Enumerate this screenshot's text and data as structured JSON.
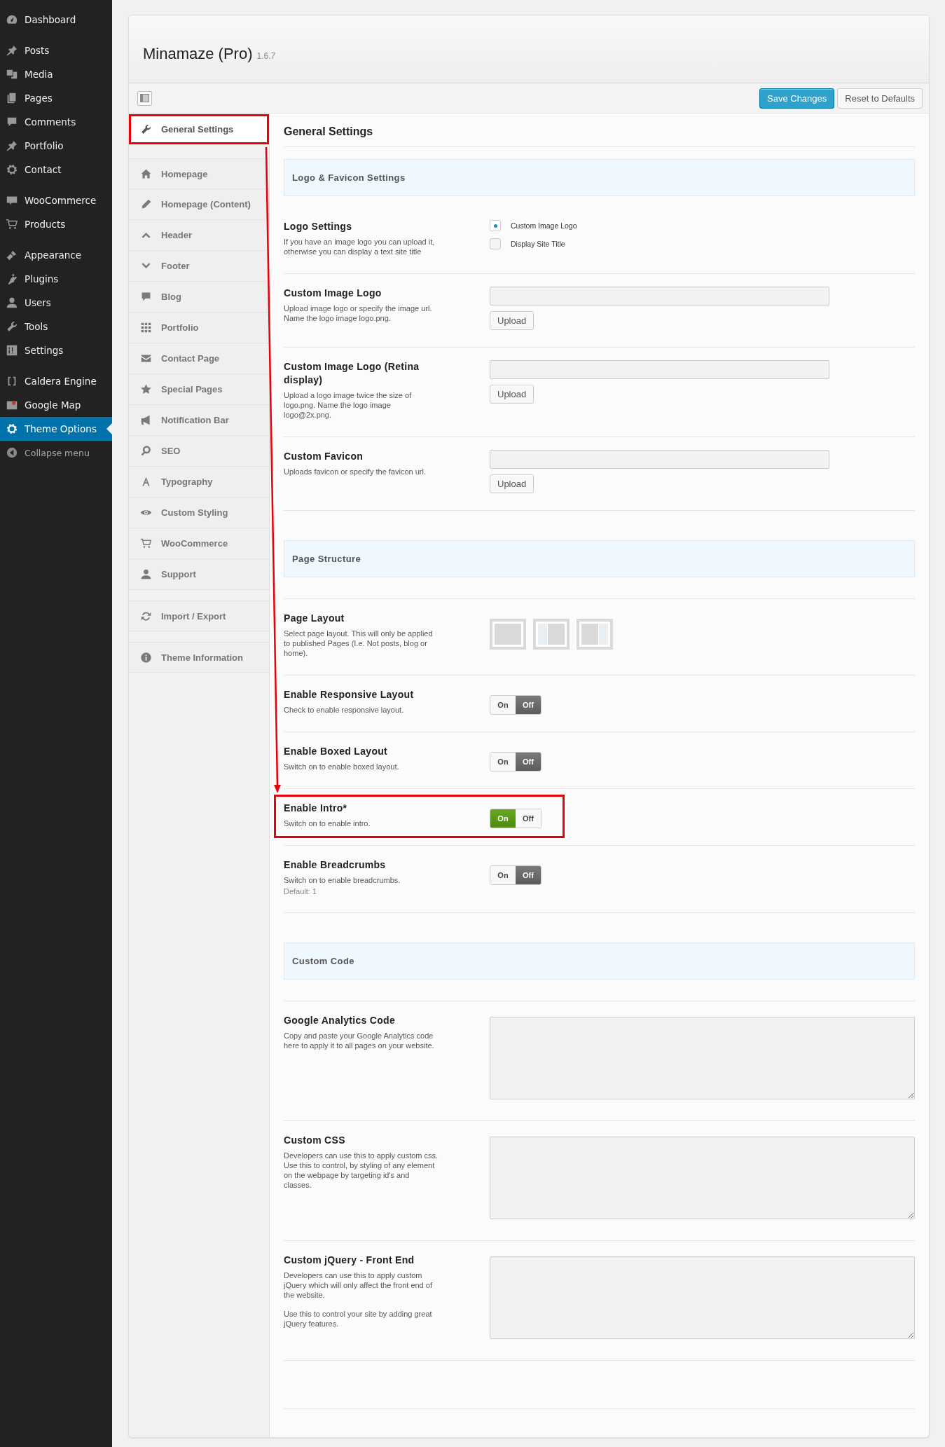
{
  "admin_menu": {
    "groups": [
      [
        {
          "label": "Dashboard",
          "selected": false
        }
      ],
      [
        {
          "label": "Posts",
          "selected": false
        },
        {
          "label": "Media",
          "selected": false
        },
        {
          "label": "Pages",
          "selected": false
        },
        {
          "label": "Comments",
          "selected": false
        },
        {
          "label": "Portfolio",
          "selected": false
        },
        {
          "label": "Contact",
          "selected": false
        }
      ],
      [
        {
          "label": "WooCommerce",
          "selected": false
        },
        {
          "label": "Products",
          "selected": false
        }
      ],
      [
        {
          "label": "Appearance",
          "selected": false
        },
        {
          "label": "Plugins",
          "selected": false
        },
        {
          "label": "Users",
          "selected": false
        },
        {
          "label": "Tools",
          "selected": false
        },
        {
          "label": "Settings",
          "selected": false
        }
      ],
      [
        {
          "label": "Caldera Engine",
          "selected": false
        },
        {
          "label": "Google Map",
          "selected": false
        },
        {
          "label": "Theme Options",
          "selected": true
        }
      ]
    ],
    "collapse": "Collapse menu"
  },
  "panel": {
    "title": "Minamaze (Pro)",
    "version": "1.6.7",
    "buttons": [
      {
        "label": "Save Changes",
        "kind": "primary"
      },
      {
        "label": "Reset to Defaults",
        "kind": "secondary"
      }
    ]
  },
  "nav": {
    "groups": [
      [
        {
          "label": "General Settings",
          "selected": true,
          "highlighted": true
        }
      ],
      [
        {
          "label": "Homepage",
          "selected": false,
          "highlighted": false
        },
        {
          "label": "Homepage (Content)",
          "selected": false,
          "highlighted": false
        },
        {
          "label": "Header",
          "selected": false,
          "highlighted": false
        },
        {
          "label": "Footer",
          "selected": false,
          "highlighted": false
        },
        {
          "label": "Blog",
          "selected": false,
          "highlighted": false
        },
        {
          "label": "Portfolio",
          "selected": false,
          "highlighted": false
        },
        {
          "label": "Contact Page",
          "selected": false,
          "highlighted": false
        },
        {
          "label": "Special Pages",
          "selected": false,
          "highlighted": false
        },
        {
          "label": "Notification Bar",
          "selected": false,
          "highlighted": false
        },
        {
          "label": "SEO",
          "selected": false,
          "highlighted": false
        },
        {
          "label": "Typography",
          "selected": false,
          "highlighted": false
        },
        {
          "label": "Custom Styling",
          "selected": false,
          "highlighted": false
        },
        {
          "label": "WooCommerce",
          "selected": false,
          "highlighted": false
        },
        {
          "label": "Support",
          "selected": false,
          "highlighted": false
        }
      ],
      [
        {
          "label": "Import / Export",
          "selected": false,
          "highlighted": false
        }
      ],
      [
        {
          "label": "Theme Information",
          "selected": false,
          "highlighted": false
        }
      ]
    ]
  },
  "content": {
    "title": "General Settings",
    "sections": [
      {
        "title": "Logo & Favicon Settings",
        "fields": [
          {
            "kind": "radio",
            "title": "Logo Settings",
            "description": [
              "If you have an image logo you can upload it, otherwise you can display a text site title"
            ],
            "highlighted": false,
            "options": [
              {
                "label": "Custom Image Logo",
                "selected": true
              },
              {
                "label": "Display Site Title",
                "selected": false
              }
            ]
          },
          {
            "kind": "upload",
            "title": "Custom Image Logo",
            "description": [
              "Upload image logo or specify the image url. Name the logo image logo.png."
            ],
            "highlighted": false,
            "button": "Upload"
          },
          {
            "kind": "upload",
            "title": "Custom Image Logo (Retina display)",
            "description": [
              "Upload a logo image twice the size of logo.png. Name the logo image logo@2x.png."
            ],
            "highlighted": false,
            "button": "Upload"
          },
          {
            "kind": "upload",
            "title": "Custom Favicon",
            "description": [
              "Uploads favicon or specify the favicon url."
            ],
            "highlighted": false,
            "button": "Upload"
          }
        ]
      },
      {
        "title": "Page Structure",
        "fields": [
          {
            "kind": "layout",
            "title": "Page Layout",
            "description": [
              "Select page layout. This will only be applied to published Pages (I.e. Not posts, blog or home)."
            ],
            "highlighted": false,
            "options": [
              {
                "kind": "full"
              },
              {
                "kind": "left"
              },
              {
                "kind": "right"
              }
            ]
          },
          {
            "kind": "toggle",
            "title": "Enable Responsive Layout",
            "description": [
              "Check to enable responsive layout."
            ],
            "highlighted": false,
            "on": false,
            "on_label": "On",
            "off_label": "Off"
          },
          {
            "kind": "toggle",
            "title": "Enable Boxed Layout",
            "description": [
              "Switch on to enable boxed layout."
            ],
            "highlighted": false,
            "on": false,
            "on_label": "On",
            "off_label": "Off"
          },
          {
            "kind": "toggle",
            "title": "Enable Intro*",
            "description": [
              "Switch on to enable intro."
            ],
            "highlighted": true,
            "on": true,
            "on_label": "On",
            "off_label": "Off"
          },
          {
            "kind": "toggle",
            "title": "Enable Breadcrumbs",
            "description": [
              "Switch on to enable breadcrumbs."
            ],
            "note": "Default: 1",
            "highlighted": false,
            "on": false,
            "on_label": "On",
            "off_label": "Off"
          }
        ]
      },
      {
        "title": "Custom Code",
        "fields": [
          {
            "kind": "textarea",
            "title": "Google Analytics Code",
            "description": [
              "Copy and paste your Google Analytics code here to apply it to all pages on your website."
            ],
            "highlighted": false
          },
          {
            "kind": "textarea",
            "title": "Custom CSS",
            "description": [
              "Developers can use this to apply custom css. Use this to control, by styling of any element on the webpage by targeting id's and classes."
            ],
            "highlighted": false
          },
          {
            "kind": "textarea",
            "title": "Custom jQuery - Front End",
            "description": [
              "Developers can use this to apply custom jQuery which will only affect the front end of the website.",
              "Use this to control your site by adding great jQuery features."
            ],
            "highlighted": false
          }
        ]
      }
    ]
  }
}
